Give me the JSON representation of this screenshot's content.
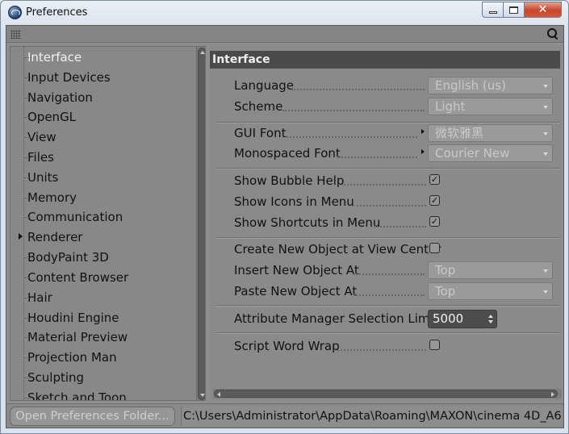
{
  "window": {
    "title": "Preferences",
    "icon": "cinema4d-app-icon"
  },
  "sidebar": {
    "items": [
      {
        "label": "Interface",
        "selected": true
      },
      {
        "label": "Input Devices"
      },
      {
        "label": "Navigation"
      },
      {
        "label": "OpenGL"
      },
      {
        "label": "View"
      },
      {
        "label": "Files"
      },
      {
        "label": "Units"
      },
      {
        "label": "Memory"
      },
      {
        "label": "Communication"
      },
      {
        "label": "Renderer",
        "expandable": true
      },
      {
        "label": "BodyPaint 3D"
      },
      {
        "label": "Content Browser"
      },
      {
        "label": "Hair"
      },
      {
        "label": "Houdini Engine"
      },
      {
        "label": "Material Preview"
      },
      {
        "label": "Projection Man"
      },
      {
        "label": "Sculpting"
      },
      {
        "label": "Sketch and Toon"
      }
    ]
  },
  "panel": {
    "header": "Interface",
    "language": {
      "label": "Language",
      "value": "English (us)"
    },
    "scheme": {
      "label": "Scheme",
      "value": "Light"
    },
    "gui_font": {
      "label": "GUI Font",
      "value": "微软雅黑"
    },
    "mono_font": {
      "label": "Monospaced Font",
      "value": "Courier New"
    },
    "bubble_help": {
      "label": "Show Bubble Help",
      "checked": true
    },
    "icons_menu": {
      "label": "Show Icons in Menu",
      "checked": true
    },
    "shortcuts_menu": {
      "label": "Show Shortcuts in Menu",
      "checked": true
    },
    "view_center": {
      "label": "Create New Object at View Center",
      "checked": false
    },
    "insert_at": {
      "label": "Insert New Object At",
      "value": "Top"
    },
    "paste_at": {
      "label": "Paste New Object At",
      "value": "Top"
    },
    "attr_limit": {
      "label": "Attribute Manager Selection Limit",
      "value": "5000"
    },
    "word_wrap": {
      "label": "Script Word Wrap",
      "checked": false
    }
  },
  "bottom": {
    "open_folder_label": "Open Preferences Folder...",
    "path": "C:\\Users\\Administrator\\AppData\\Roaming\\MAXON\\cinema 4D_A6"
  },
  "check_glyph": "✓",
  "close_glyph": "✕"
}
